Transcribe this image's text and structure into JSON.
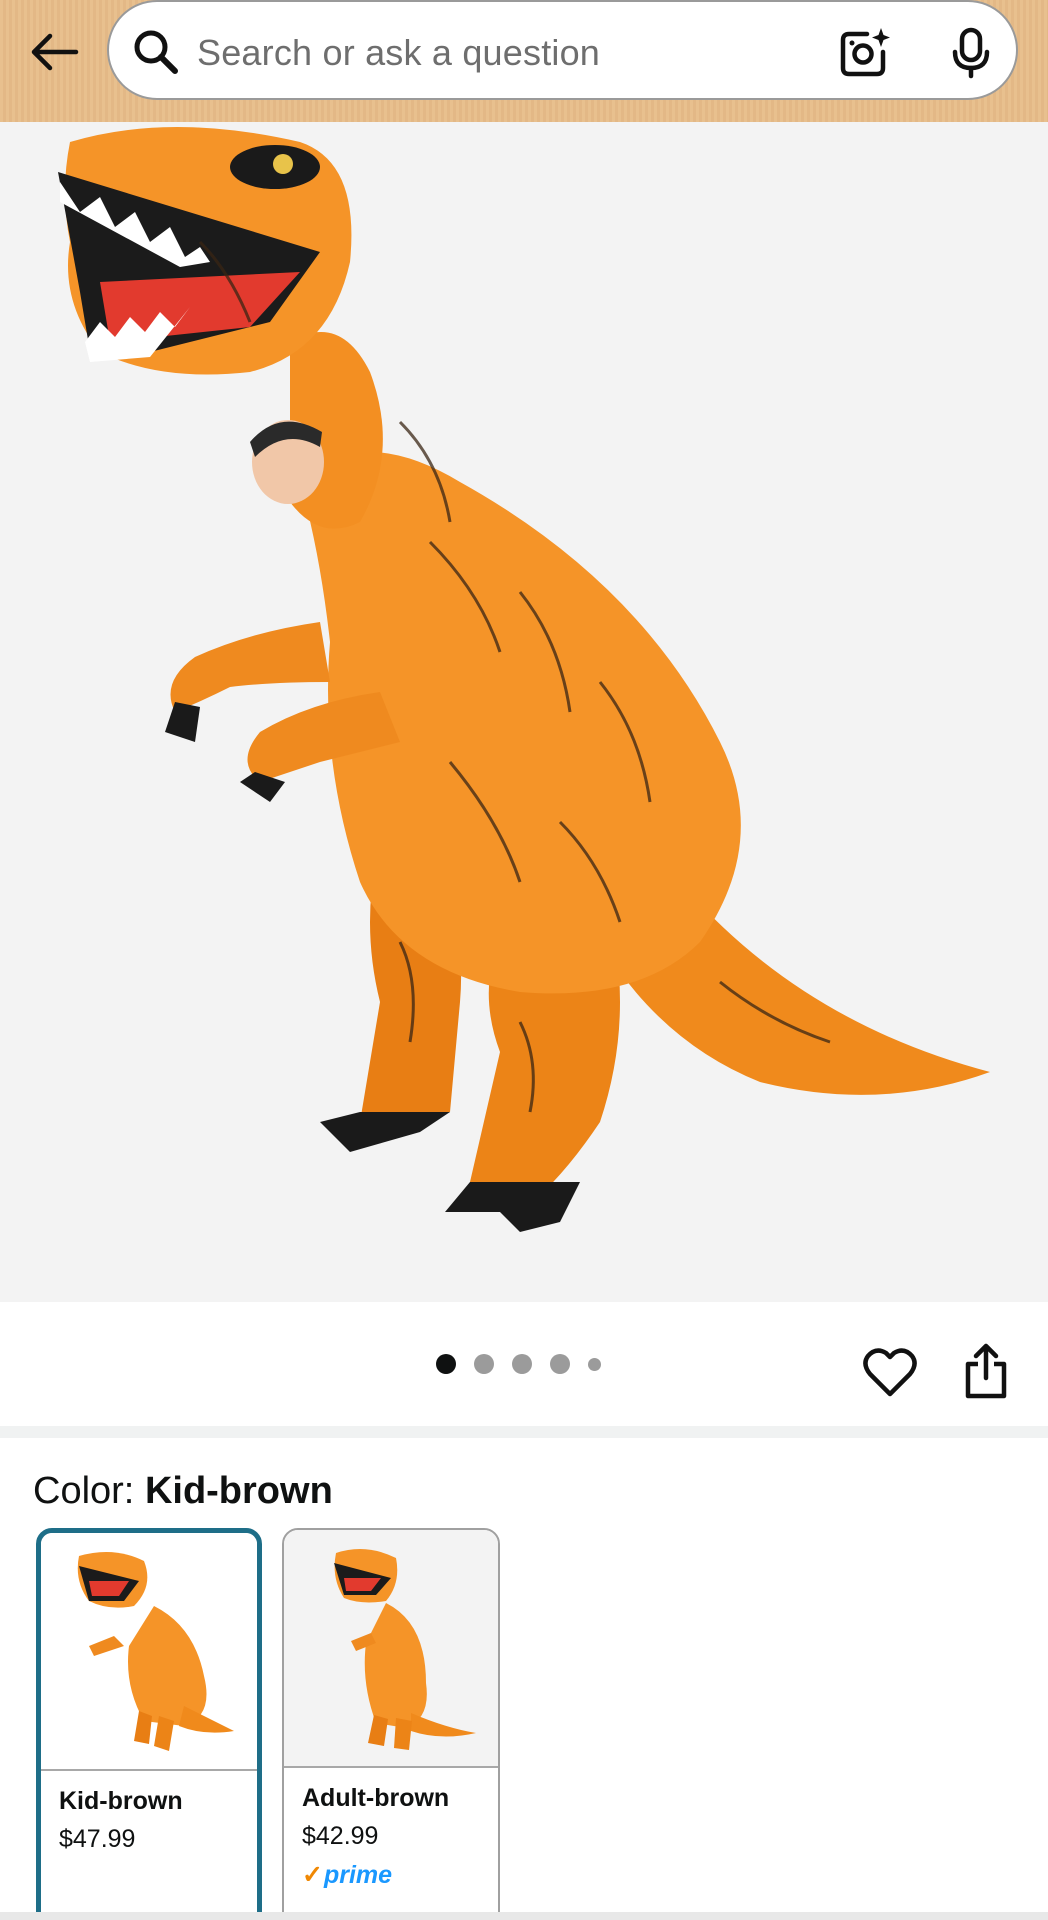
{
  "header": {
    "search_placeholder": "Search or ask a question",
    "icons": [
      "back-arrow-icon",
      "search-icon",
      "camera-lens-icon",
      "microphone-icon"
    ],
    "colors": {
      "header_bg": "#e8c08e",
      "search_border": "#9a9a9a"
    }
  },
  "gallery": {
    "image_count": 5,
    "active_index": 0,
    "icons": [
      "heart-icon",
      "share-icon"
    ]
  },
  "color_selector": {
    "label": "Color:",
    "selected_value": "Kid-brown",
    "options": [
      {
        "name": "Kid-brown",
        "price": "$47.99",
        "prime": "",
        "selected": true
      },
      {
        "name": "Adult-brown",
        "price": "$42.99",
        "prime": "prime",
        "selected": false
      }
    ],
    "colors": {
      "selected_border": "#1e6e88",
      "prime_blue": "#1a98ff",
      "prime_check": "#f08804"
    }
  }
}
